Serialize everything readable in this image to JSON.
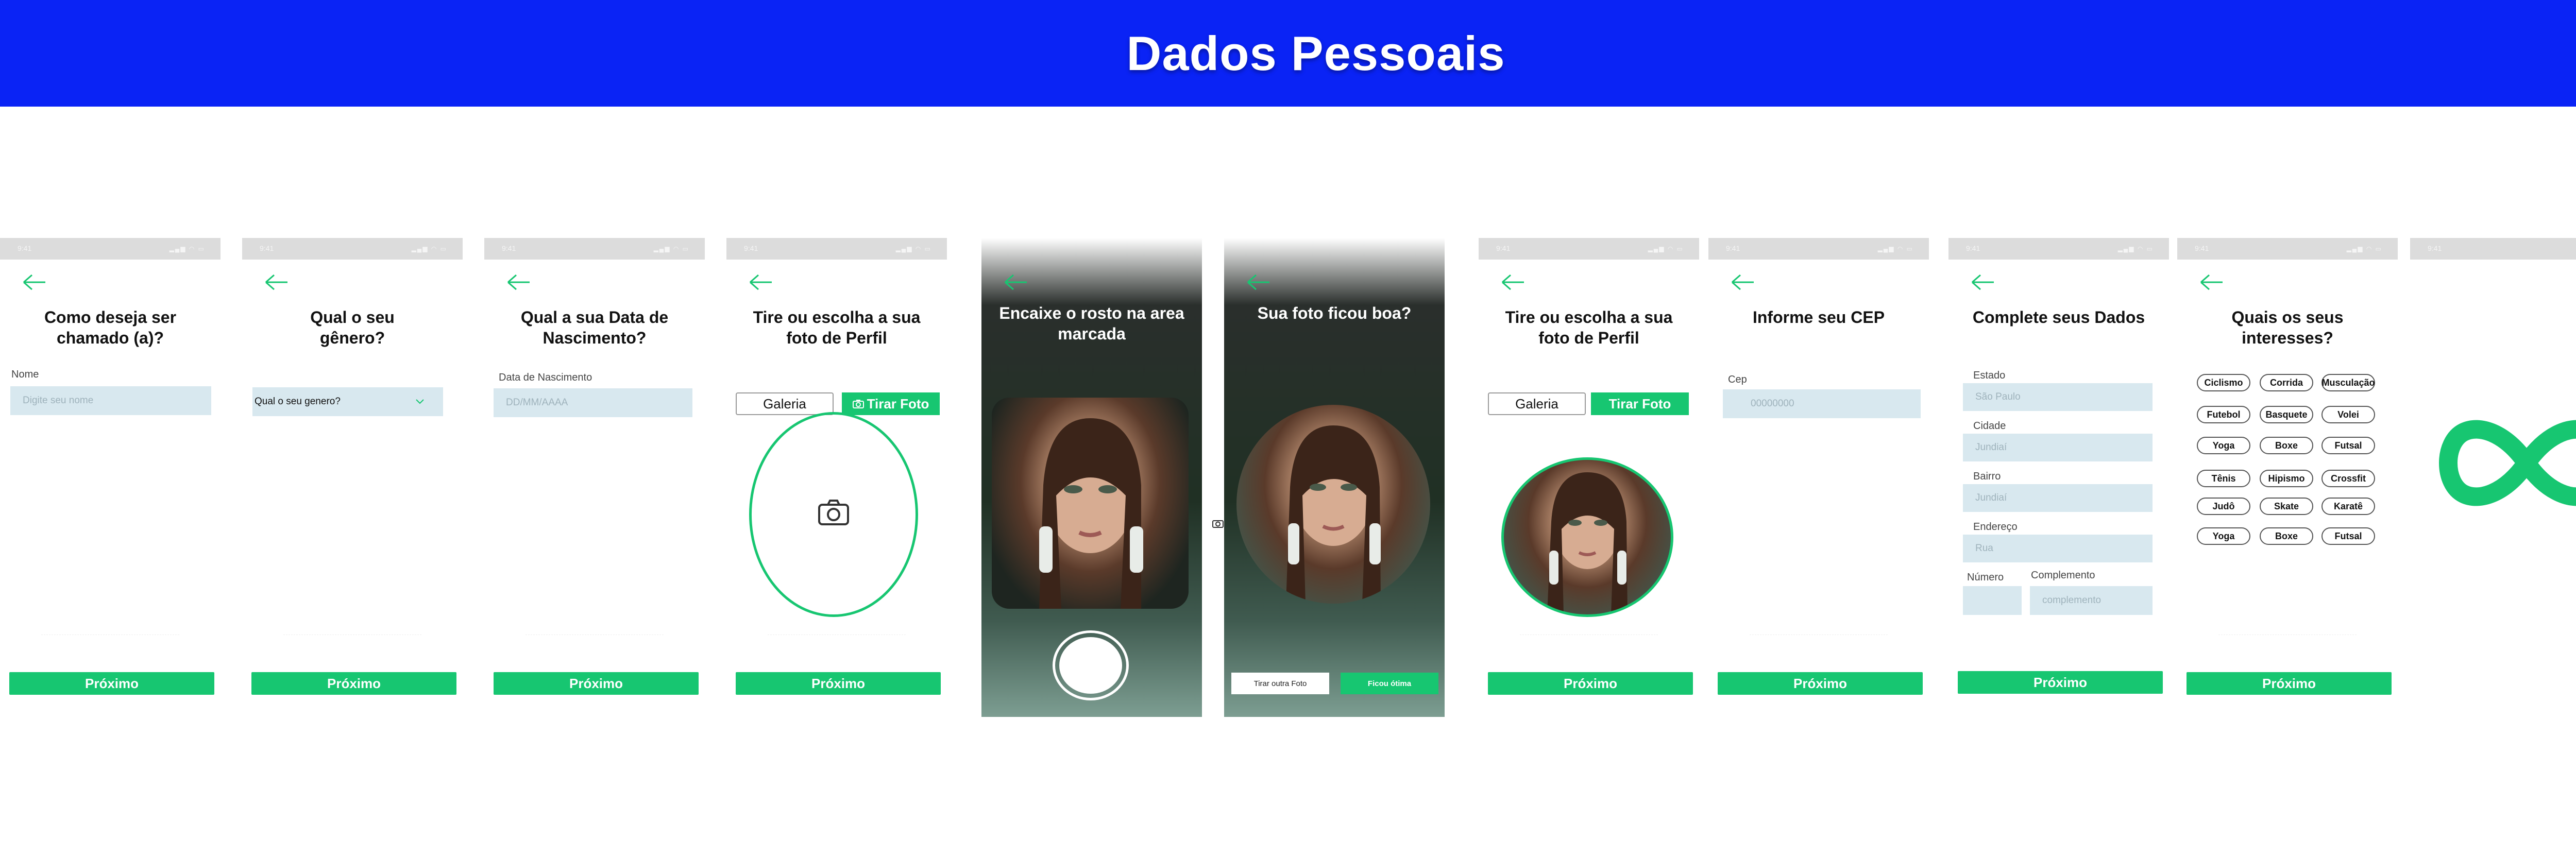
{
  "header": {
    "title": "Dados Pessoais"
  },
  "statusbar": {
    "time": "9:41",
    "icons": "▂▄▆ ◠ ▭"
  },
  "common": {
    "next_label": "Próximo"
  },
  "screen1": {
    "title": "Como deseja ser chamado (a)?",
    "label": "Nome",
    "placeholder": "Digite seu nome"
  },
  "screen2": {
    "title": "Qual o seu gênero?",
    "select_value": "Qual o seu genero?"
  },
  "screen3": {
    "title": "Qual a sua Data de Nascimento?",
    "label": "Data de Nascimento",
    "placeholder": "DD/MM/AAAA"
  },
  "screen4": {
    "title": "Tire ou escolha a sua foto de Perfil",
    "gallery_label": "Galeria",
    "take_label": "Tirar Foto",
    "take_icon": "camera-icon"
  },
  "screen5": {
    "title": "Encaixe o rosto na area marcada"
  },
  "screen6": {
    "title": "Sua foto ficou boa?",
    "retake_label": "Tirar outra Foto",
    "ok_label": "Ficou ótima"
  },
  "screen7": {
    "title": "Tire ou escolha a sua foto de Perfil",
    "gallery_label": "Galeria",
    "take_label": "Tirar Foto"
  },
  "screen8": {
    "title": "Informe seu CEP",
    "label": "Cep",
    "placeholder": "00000000"
  },
  "screen9": {
    "title": "Complete seus Dados",
    "fields": [
      {
        "label": "Estado",
        "placeholder": "São Paulo"
      },
      {
        "label": "Cidade",
        "placeholder": "Jundiaí"
      },
      {
        "label": "Bairro",
        "placeholder": "Jundiaí"
      },
      {
        "label": "Endereço",
        "placeholder": "Rua"
      }
    ],
    "numero_label": "Número",
    "complemento_label": "Complemento",
    "complemento_placeholder": "complemento"
  },
  "screen10": {
    "title": "Quais os seus interesses?",
    "interests": [
      [
        "Ciclismo",
        "Corrida",
        "Musculação"
      ],
      [
        "Futebol",
        "Basquete",
        "Volei"
      ],
      [
        "Yoga",
        "Boxe",
        "Futsal"
      ],
      [
        "Tênis",
        "Hipismo",
        "Crossfit"
      ],
      [
        "Judô",
        "Skate",
        "Karatê"
      ],
      [
        "Yoga",
        "Boxe",
        "Futsal"
      ]
    ]
  },
  "colors": {
    "brand_blue": "#0a23f5",
    "accent_green": "#17c671",
    "field_bg": "#d8e8ef"
  }
}
